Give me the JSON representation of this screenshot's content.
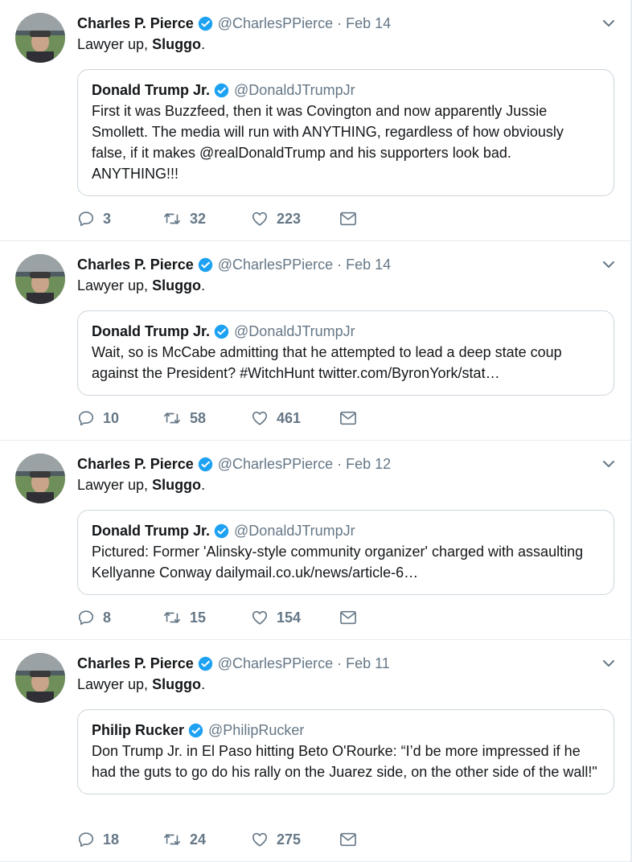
{
  "tweets": [
    {
      "name": "Charles P. Pierce",
      "handle": "@CharlesPPierce",
      "sep": "·",
      "date": "Feb 14",
      "text_prefix": "Lawyer up, ",
      "text_bold": "Sluggo",
      "text_suffix": ".",
      "quote": {
        "name": "Donald Trump Jr.",
        "handle": "@DonaldJTrumpJr",
        "text": "First it was Buzzfeed, then it was Covington and now apparently Jussie Smollett. The media will run with ANYTHING, regardless of how obviously false, if it makes @realDonaldTrump and his supporters look bad. ANYTHING!!!"
      },
      "replies": "3",
      "retweets": "32",
      "likes": "223"
    },
    {
      "name": "Charles P. Pierce",
      "handle": "@CharlesPPierce",
      "sep": "·",
      "date": "Feb 14",
      "text_prefix": "Lawyer up, ",
      "text_bold": "Sluggo",
      "text_suffix": ".",
      "quote": {
        "name": "Donald Trump Jr.",
        "handle": "@DonaldJTrumpJr",
        "text": "Wait, so is McCabe admitting that he attempted to lead a deep state coup against the President? #WitchHunt twitter.com/ByronYork/stat…"
      },
      "replies": "10",
      "retweets": "58",
      "likes": "461"
    },
    {
      "name": "Charles P. Pierce",
      "handle": "@CharlesPPierce",
      "sep": "·",
      "date": "Feb 12",
      "text_prefix": "Lawyer up, ",
      "text_bold": "Sluggo",
      "text_suffix": ".",
      "quote": {
        "name": "Donald Trump Jr.",
        "handle": "@DonaldJTrumpJr",
        "text": "Pictured: Former 'Alinsky-style community organizer' charged with assaulting Kellyanne Conway dailymail.co.uk/news/article-6…"
      },
      "replies": "8",
      "retweets": "15",
      "likes": "154"
    },
    {
      "name": "Charles P. Pierce",
      "handle": "@CharlesPPierce",
      "sep": "·",
      "date": "Feb 11",
      "text_prefix": "Lawyer up, ",
      "text_bold": "Sluggo",
      "text_suffix": ".",
      "quote": {
        "name": "Philip Rucker",
        "handle": "@PhilipRucker",
        "text": "Don Trump Jr. in El Paso hitting Beto O'Rourke: “I’d be more impressed if he had the guts to go do his rally on the Juarez side, on the other side of the wall!\""
      },
      "replies": "18",
      "retweets": "24",
      "likes": "275"
    }
  ],
  "icons": {
    "verified": "verified-badge-icon",
    "more": "chevron-down-icon",
    "reply": "reply-icon",
    "retweet": "retweet-icon",
    "like": "heart-icon",
    "dm": "envelope-icon"
  },
  "colors": {
    "verified": "#1da1f2",
    "secondary_text": "#657786",
    "border": "#e6ecf0",
    "quote_border": "#ccd6dd"
  }
}
